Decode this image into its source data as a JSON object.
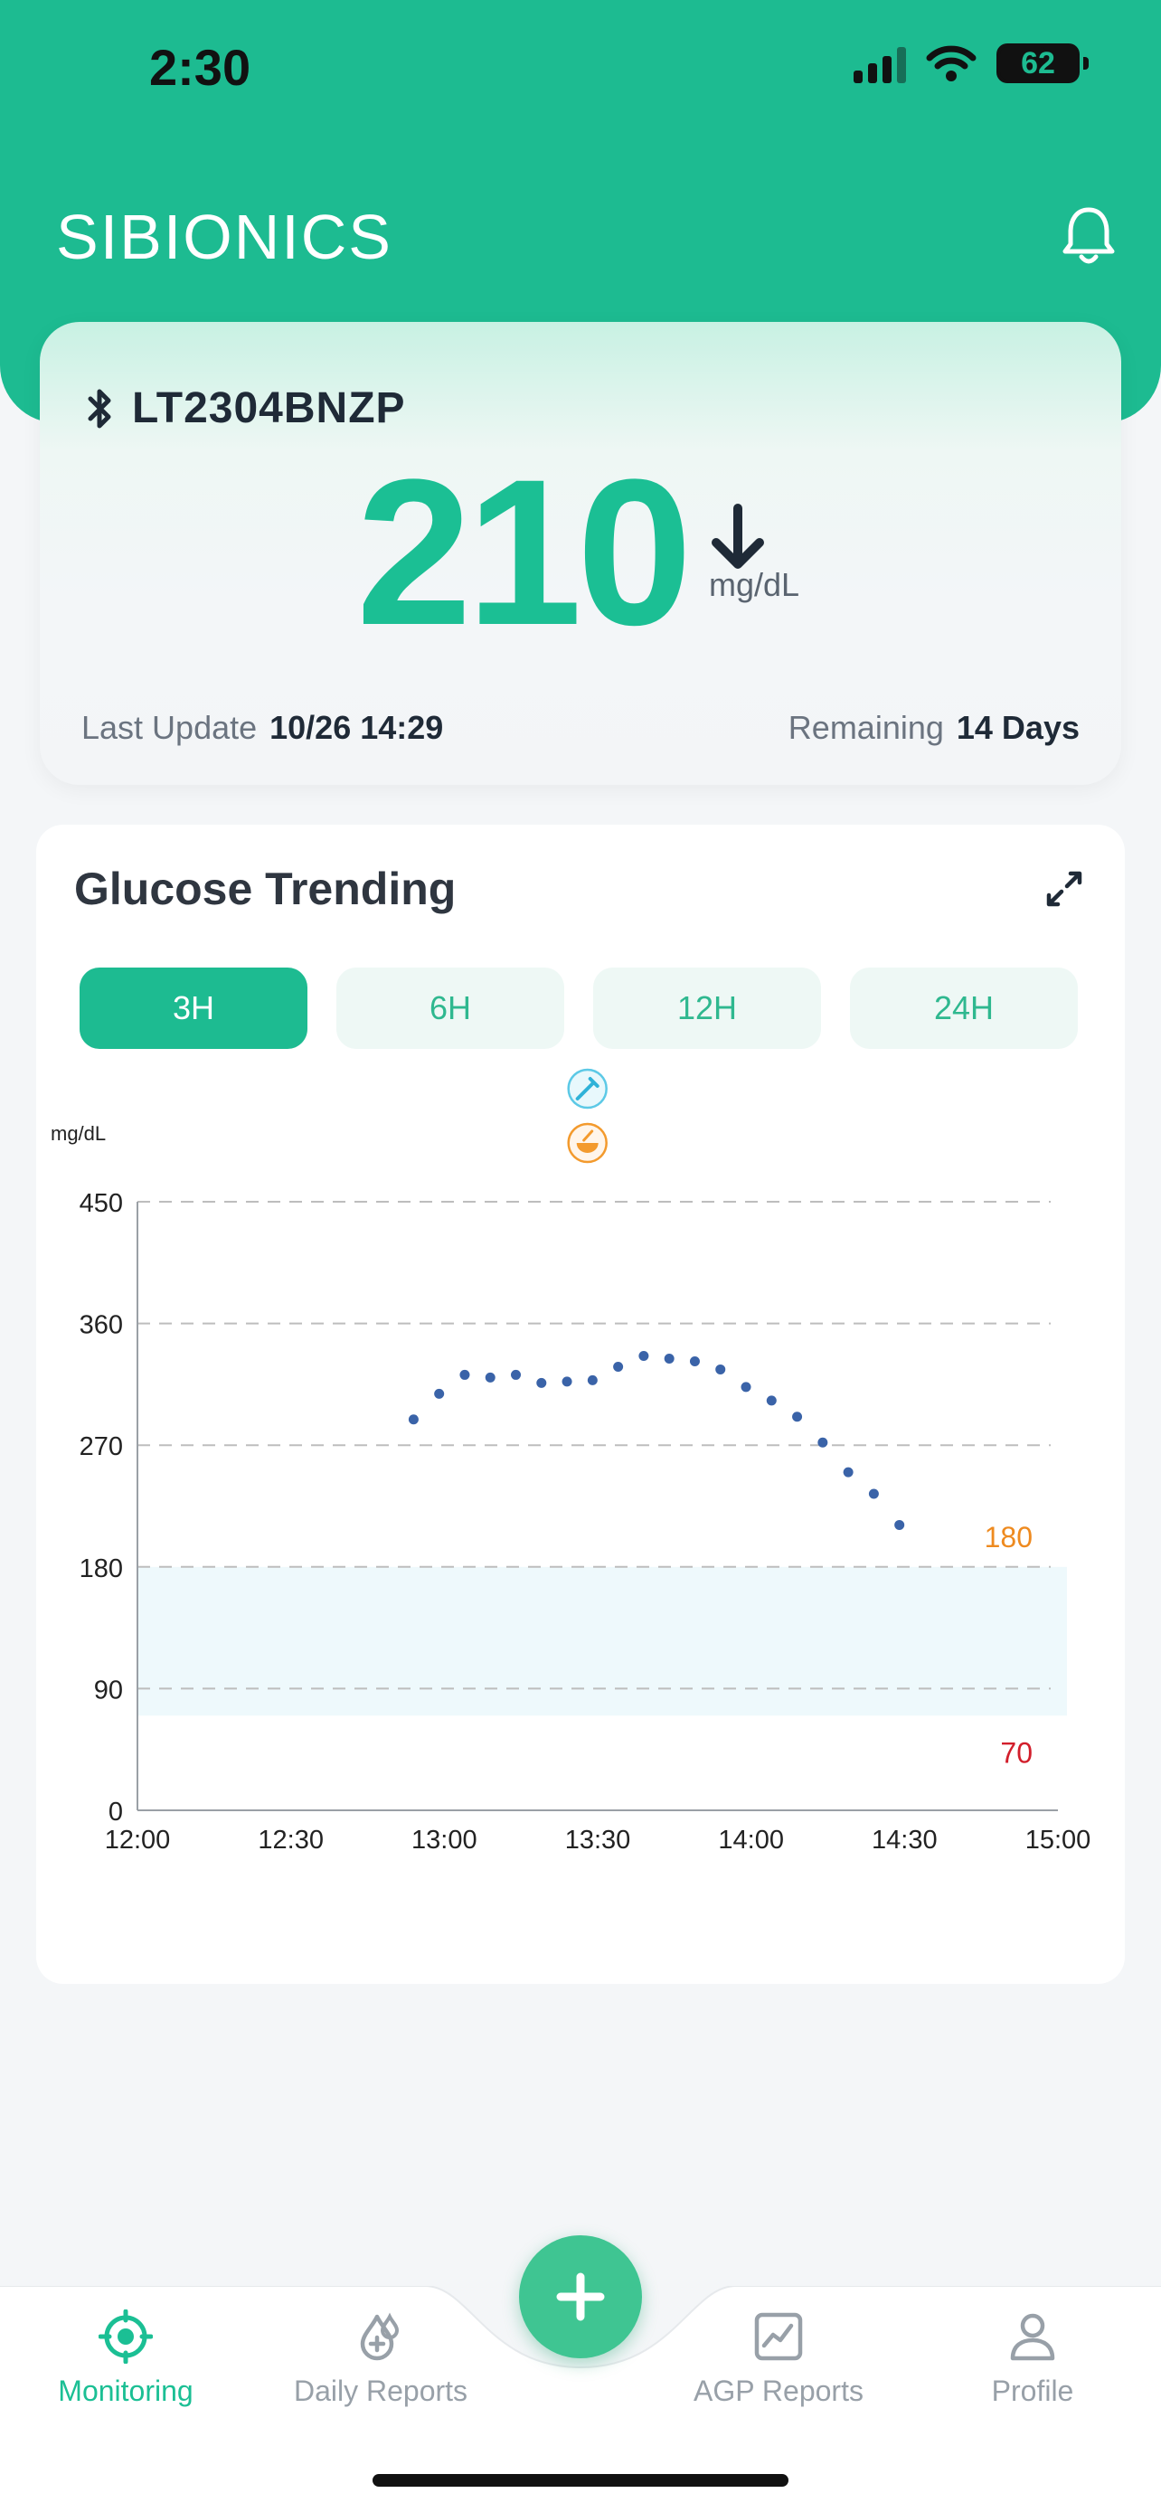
{
  "status_bar": {
    "time": "2:30",
    "battery": "62"
  },
  "header": {
    "brand": "SIBIONICS"
  },
  "reading": {
    "device_id": "LT2304BNZP",
    "value": "210",
    "unit": "mg/dL",
    "last_update_label": "Last Update",
    "last_update_value": "10/26 14:29",
    "remaining_label": "Remaining",
    "remaining_value": "14 Days"
  },
  "chart_card": {
    "title": "Glucose Trending",
    "ranges": [
      {
        "label": "3H",
        "active": true
      },
      {
        "label": "6H",
        "active": false
      },
      {
        "label": "12H",
        "active": false
      },
      {
        "label": "24H",
        "active": false
      }
    ]
  },
  "chart_data": {
    "type": "scatter",
    "ylabel": "mg/dL",
    "xlim": [
      "12:00",
      "15:00"
    ],
    "ylim": [
      0,
      450
    ],
    "x_ticks": [
      "12:00",
      "12:30",
      "13:00",
      "13:30",
      "14:00",
      "14:30",
      "15:00"
    ],
    "y_ticks": [
      0,
      90,
      180,
      270,
      360,
      450
    ],
    "target_range": {
      "low": 70,
      "high": 180,
      "low_label": "70",
      "high_label": "180"
    },
    "grid": "dashed horizontal",
    "events": [
      {
        "time": "13:28",
        "icon": "insulin-pen-icon"
      },
      {
        "time": "13:28",
        "icon": "meal-bowl-icon"
      }
    ],
    "points": [
      {
        "x": "12:54",
        "y": 289
      },
      {
        "x": "12:59",
        "y": 308
      },
      {
        "x": "13:04",
        "y": 322
      },
      {
        "x": "13:09",
        "y": 320
      },
      {
        "x": "13:14",
        "y": 322
      },
      {
        "x": "13:19",
        "y": 316
      },
      {
        "x": "13:24",
        "y": 317
      },
      {
        "x": "13:29",
        "y": 318
      },
      {
        "x": "13:34",
        "y": 328
      },
      {
        "x": "13:39",
        "y": 336
      },
      {
        "x": "13:44",
        "y": 334
      },
      {
        "x": "13:49",
        "y": 332
      },
      {
        "x": "13:54",
        "y": 326
      },
      {
        "x": "13:59",
        "y": 313
      },
      {
        "x": "14:04",
        "y": 303
      },
      {
        "x": "14:09",
        "y": 291
      },
      {
        "x": "14:14",
        "y": 272
      },
      {
        "x": "14:19",
        "y": 250
      },
      {
        "x": "14:24",
        "y": 234
      },
      {
        "x": "14:29",
        "y": 211
      }
    ]
  },
  "nav": {
    "items": [
      {
        "label": "Monitoring",
        "active": true
      },
      {
        "label": "Daily Reports",
        "active": false
      },
      {
        "label": "AGP Reports",
        "active": false
      },
      {
        "label": "Profile",
        "active": false
      }
    ]
  },
  "colors": {
    "brand": "#1dbb91",
    "value": "#1bbf94",
    "point": "#3a63a8",
    "high_label": "#ee8a1f",
    "low_label": "#d21e2b",
    "target_band": "#eef9fc"
  }
}
